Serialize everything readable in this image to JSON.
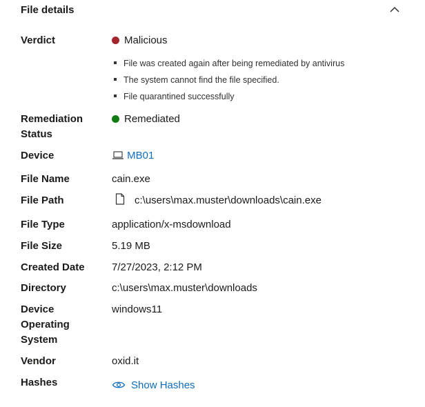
{
  "header": {
    "title": "File details",
    "collapse_icon": "chevron-up-icon"
  },
  "colors": {
    "malicious": "#a4262c",
    "remediated": "#107c10",
    "link": "#0f6cbd"
  },
  "verdict": {
    "label": "Verdict",
    "value": "Malicious",
    "reasons": [
      "File was created again after being remediated by antivirus",
      "The system cannot find the file specified.",
      "File quarantined successfully"
    ]
  },
  "remediation": {
    "label_line1": "Remediation",
    "label_line2": "Status",
    "value": "Remediated"
  },
  "device": {
    "label": "Device",
    "value": "MB01",
    "icon": "laptop-icon"
  },
  "file_name": {
    "label": "File Name",
    "value": "cain.exe"
  },
  "file_path": {
    "label": "File Path",
    "value": "c:\\users\\max.muster\\downloads\\cain.exe",
    "icon": "file-icon"
  },
  "file_type": {
    "label": "File Type",
    "value": "application/x-msdownload"
  },
  "file_size": {
    "label": "File Size",
    "value": "5.19 MB"
  },
  "created_date": {
    "label": "Created Date",
    "value": "7/27/2023, 2:12 PM"
  },
  "directory": {
    "label": "Directory",
    "value": "c:\\users\\max.muster\\downloads"
  },
  "device_os": {
    "label_line1": "Device",
    "label_line2": "Operating",
    "label_line3": "System",
    "value": "windows11"
  },
  "vendor": {
    "label": "Vendor",
    "value": "oxid.it"
  },
  "hashes": {
    "label": "Hashes",
    "link_label": "Show Hashes",
    "icon": "eye-icon"
  }
}
